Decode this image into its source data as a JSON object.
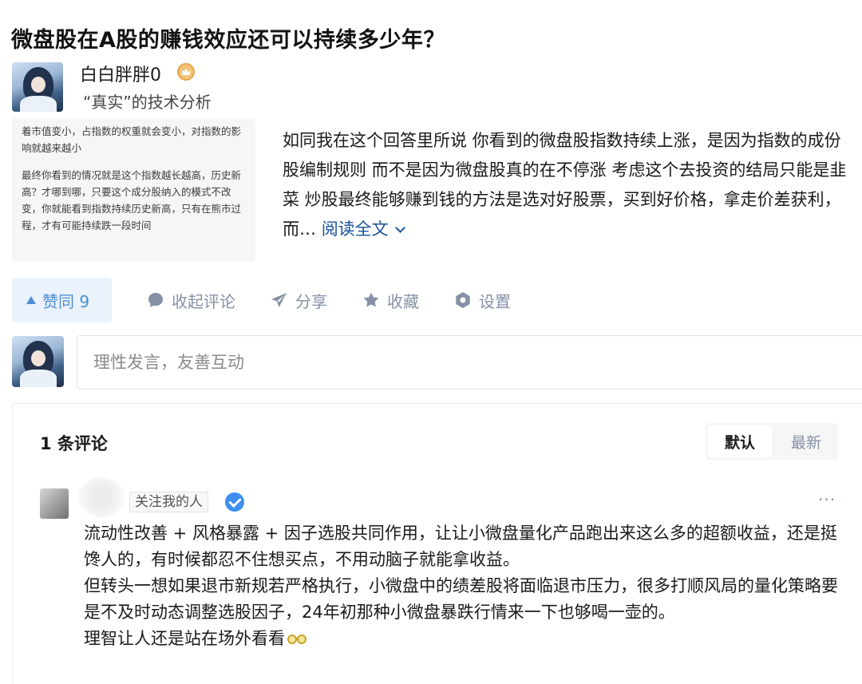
{
  "question": {
    "title": "微盘股在A股的赚钱效应还可以持续多少年？"
  },
  "author": {
    "name": "白白胖胖0",
    "bio": "“真实”的技术分析"
  },
  "thumbnail": {
    "paragraph1": "着市值变小，占指数的权重就会变小，对指数的影响就越来越小",
    "paragraph2": "最终你看到的情况就是这个指数越长越高，历史新高？才哪到哪，只要这个成分股纳入的模式不改变，你就能看到指数持续历史新高，只有在熊市过程，才有可能持续跌一段时间"
  },
  "answer": {
    "excerpt": "如同我在这个回答里所说 你看到的微盘股指数持续上涨，是因为指数的成份股编制规则 而不是因为微盘股真的在不停涨 考虑这个去投资的结局只能是韭菜 炒股最终能够赚到钱的方法是选对好股票，买到好价格，拿走价差获利，而…",
    "read_more": "阅读全文"
  },
  "actions": {
    "vote_label": "赞同 9",
    "collapse_comments": "收起评论",
    "share": "分享",
    "favorite": "收藏",
    "settings": "设置"
  },
  "reply": {
    "placeholder": "理性发言，友善互动"
  },
  "comments": {
    "count_label": "1 条评论",
    "sort": {
      "default": "默认",
      "latest": "最新"
    },
    "items": [
      {
        "tag": "关注我的人",
        "lines": [
          "流动性改善 + 风格暴露 + 因子选股共同作用，让让小微盘量化产品跑出来这么多的超额收益，还是挺馋人的，有时候都忍不住想买点，不用动脑子就能拿收益。",
          "但转头一想如果退市新规若严格执行，小微盘中的绩差股将面临退市压力，很多打顺风局的量化策略要是不及时动态调整选股因子，24年初那种小微盘暴跌行情来一下也够喝一壶的。",
          "理智让人还是站在场外看看"
        ],
        "more": "···"
      }
    ]
  },
  "colors": {
    "accent": "#175199",
    "vote_bg": "#eaf2fb",
    "vote_text": "#4f8ed6",
    "muted": "#8590a6"
  },
  "icons": [
    "crown-badge-icon",
    "chevron-down-icon",
    "upvote-icon",
    "comment-icon",
    "share-icon",
    "star-icon",
    "settings-icon",
    "verified-icon",
    "more-icon",
    "glasses-emoji-icon"
  ]
}
